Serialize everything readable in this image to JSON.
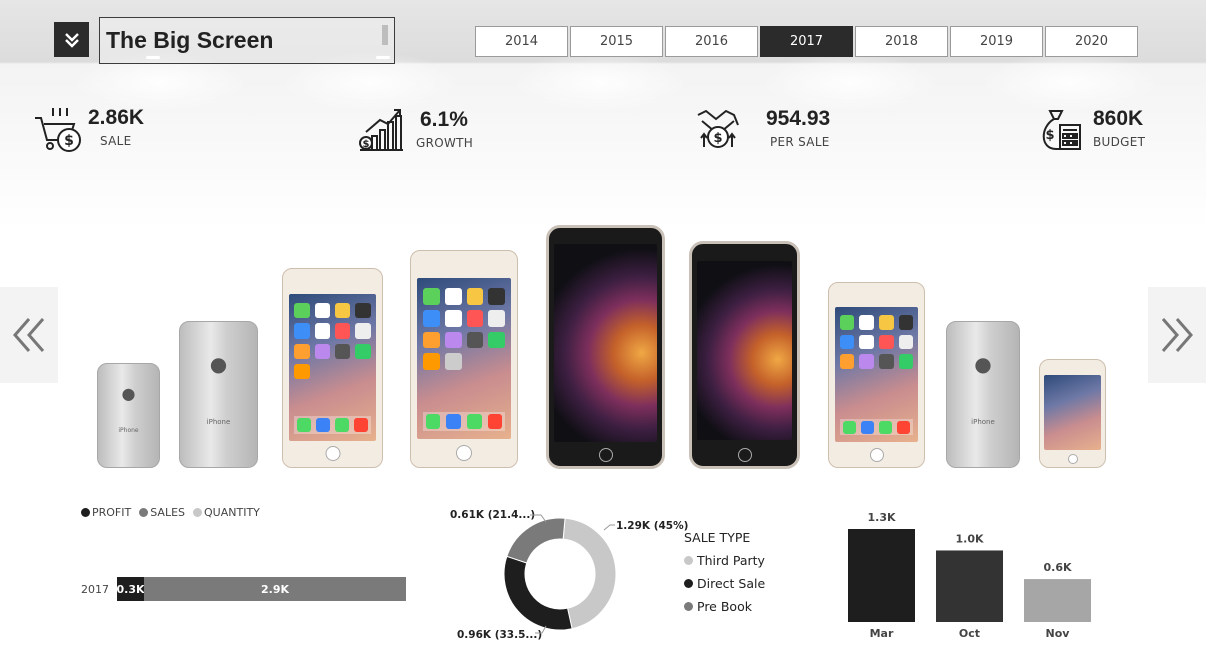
{
  "header": {
    "title": "The Big Screen",
    "years": [
      "2014",
      "2015",
      "2016",
      "2017",
      "2018",
      "2019",
      "2020"
    ],
    "active_year": "2017"
  },
  "kpis": [
    {
      "value": "2.86K",
      "label": "SALE",
      "icon": "cart-dollar-icon"
    },
    {
      "value": "6.1%",
      "label": "GROWTH",
      "icon": "growth-chart-icon"
    },
    {
      "value": "954.93",
      "label": "PER SALE",
      "icon": "handshake-dollar-icon"
    },
    {
      "value": "860K",
      "label": "BUDGET",
      "icon": "money-bag-calculator-icon"
    }
  ],
  "nav": {
    "prev_glyph": "«",
    "next_glyph": "»"
  },
  "phones": {
    "brand_text": "iPhone"
  },
  "colors": {
    "dark": "#1e1e1e",
    "mid": "#7a7a7a",
    "light": "#c8c8c8",
    "accent_dark": "#2b2b2b"
  },
  "profit_sales_quantity": {
    "legend": [
      {
        "label": "PROFIT",
        "color": "#1e1e1e"
      },
      {
        "label": "SALES",
        "color": "#7a7a7a"
      },
      {
        "label": "QUANTITY",
        "color": "#c8c8c8"
      }
    ],
    "row_label": "2017",
    "segments": [
      {
        "label": "0.3K",
        "value": 0.3,
        "color": "#1e1e1e"
      },
      {
        "label": "2.9K",
        "value": 2.9,
        "color": "#7a7a7a"
      }
    ]
  },
  "sale_type": {
    "title": "SALE TYPE",
    "items": [
      {
        "label": "Third Party",
        "color": "#c8c8c8"
      },
      {
        "label": "Direct Sale",
        "color": "#1e1e1e"
      },
      {
        "label": "Pre Book",
        "color": "#7a7a7a"
      }
    ],
    "donut_labels": [
      "1.29K (45%)",
      "0.96K (33.5...)",
      "0.61K (21.4...)"
    ]
  },
  "chart_data": [
    {
      "type": "bar",
      "orientation": "horizontal-stacked",
      "categories": [
        "2017"
      ],
      "series": [
        {
          "name": "PROFIT",
          "values": [
            0.3
          ]
        },
        {
          "name": "SALES",
          "values": [
            2.9
          ]
        }
      ]
    },
    {
      "type": "pie",
      "title": "SALE TYPE",
      "categories": [
        "Third Party",
        "Direct Sale",
        "Pre Book"
      ],
      "values": [
        1.29,
        0.96,
        0.61
      ],
      "percent": [
        45,
        33.5,
        21.4
      ],
      "donut": true
    },
    {
      "type": "bar",
      "categories": [
        "Mar",
        "Oct",
        "Nov"
      ],
      "values": [
        1.3,
        1.0,
        0.6
      ],
      "value_labels": [
        "1.3K",
        "1.0K",
        "0.6K"
      ],
      "colors": [
        "#1e1e1e",
        "#333333",
        "#a6a6a6"
      ]
    }
  ]
}
